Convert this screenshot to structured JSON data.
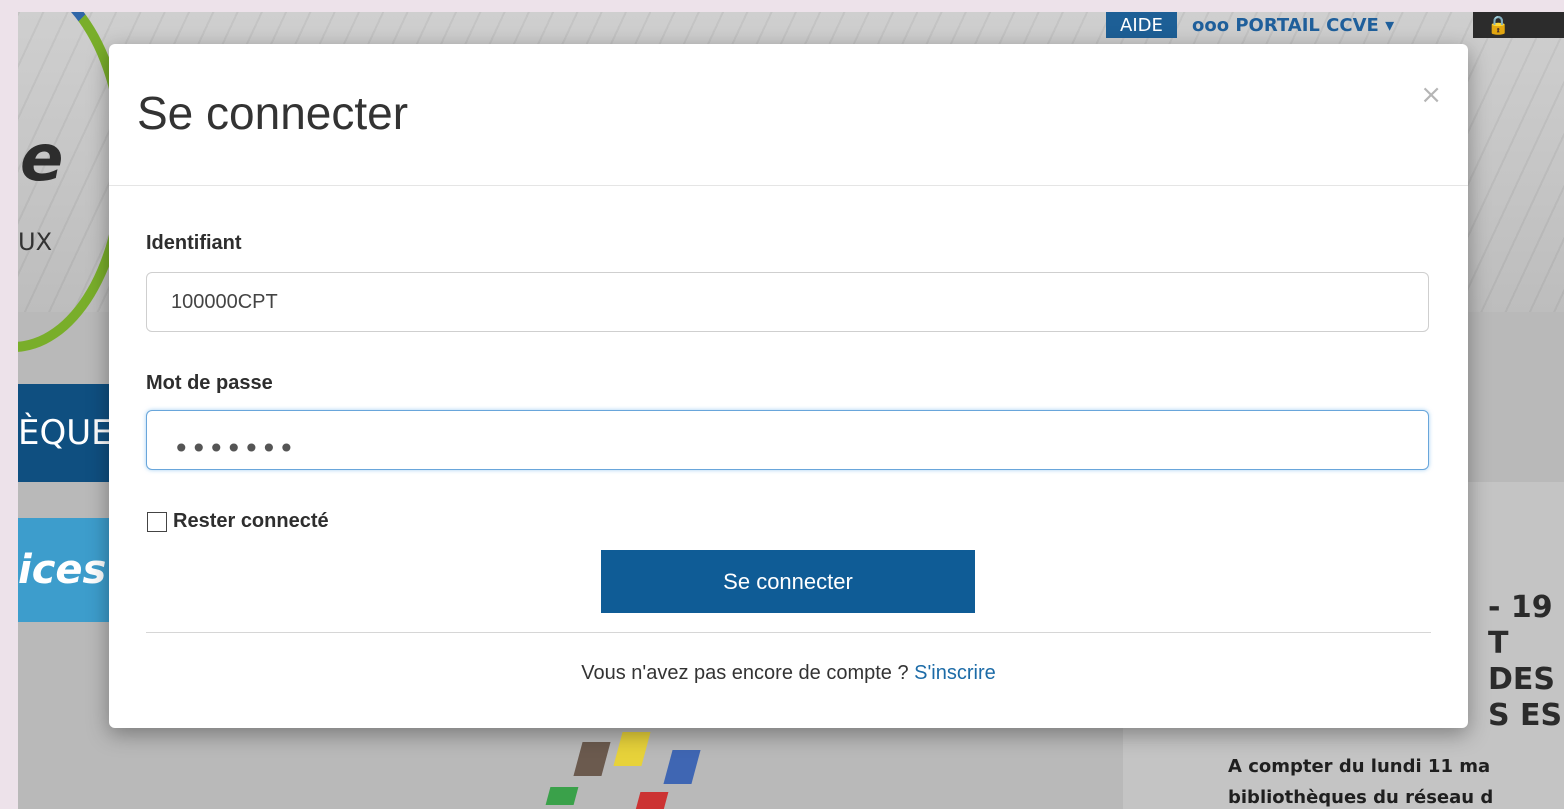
{
  "background": {
    "logo_letter": "e",
    "logo_text": "UX",
    "nav": {
      "aide": "AIDE",
      "portail": "ooo PORTAIL CCVE ▾",
      "lock_icon": "lock-icon"
    },
    "blue_nav_text": "ÈQUE",
    "services_text": "ices",
    "news_title": "- 19 : T DES S ES",
    "news_body_line1": "A compter du lundi 11 ma",
    "news_body_line2": "bibliothèques du réseau d"
  },
  "modal": {
    "title": "Se connecter",
    "close_icon": "×",
    "identifiant_label": "Identifiant",
    "identifiant_value": "100000CPT",
    "password_label": "Mot de passe",
    "password_dots": "•••••••",
    "remember_label": "Rester connecté",
    "submit_label": "Se connecter",
    "signup_text": "Vous n'avez pas encore de compte ? ",
    "signup_link": "S'inscrire"
  },
  "colors": {
    "primary": "#0f5c96",
    "link": "#1c6ba7"
  }
}
